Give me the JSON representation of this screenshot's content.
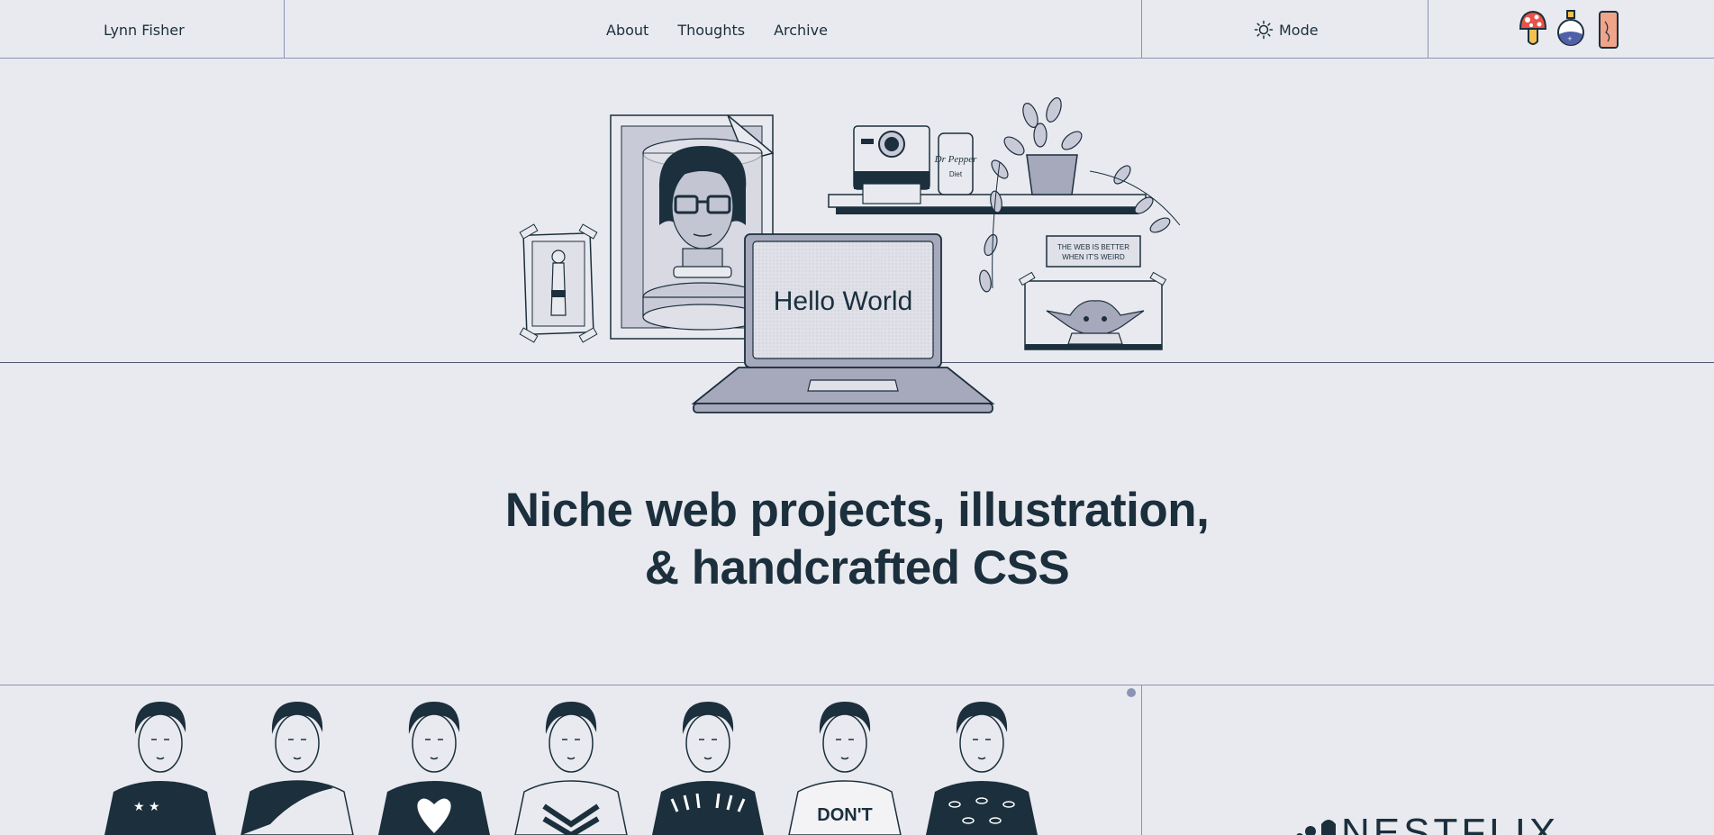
{
  "header": {
    "site_name": "Lynn Fisher",
    "nav": [
      "About",
      "Thoughts",
      "Archive"
    ],
    "mode_label": "Mode",
    "stickers": [
      "mushroom-sticker",
      "potion-sticker",
      "punk-sticker"
    ]
  },
  "hero": {
    "laptop_text": "Hello World",
    "sign_line1": "THE WEB IS BETTER",
    "sign_line2": "WHEN IT'S WEIRD",
    "can_text": "Dr Pepper",
    "can_sub": "Diet",
    "headline_line1": "Niche web projects, illustration,",
    "headline_line2": "& handcrafted CSS"
  },
  "projects": {
    "shirt_text": "DON'T",
    "logo_text": "NESTFLIX"
  },
  "colors": {
    "background": "#e9eaef",
    "ink": "#1b2f3d",
    "rule": "#8c93b5",
    "muted": "#c9cad8"
  }
}
